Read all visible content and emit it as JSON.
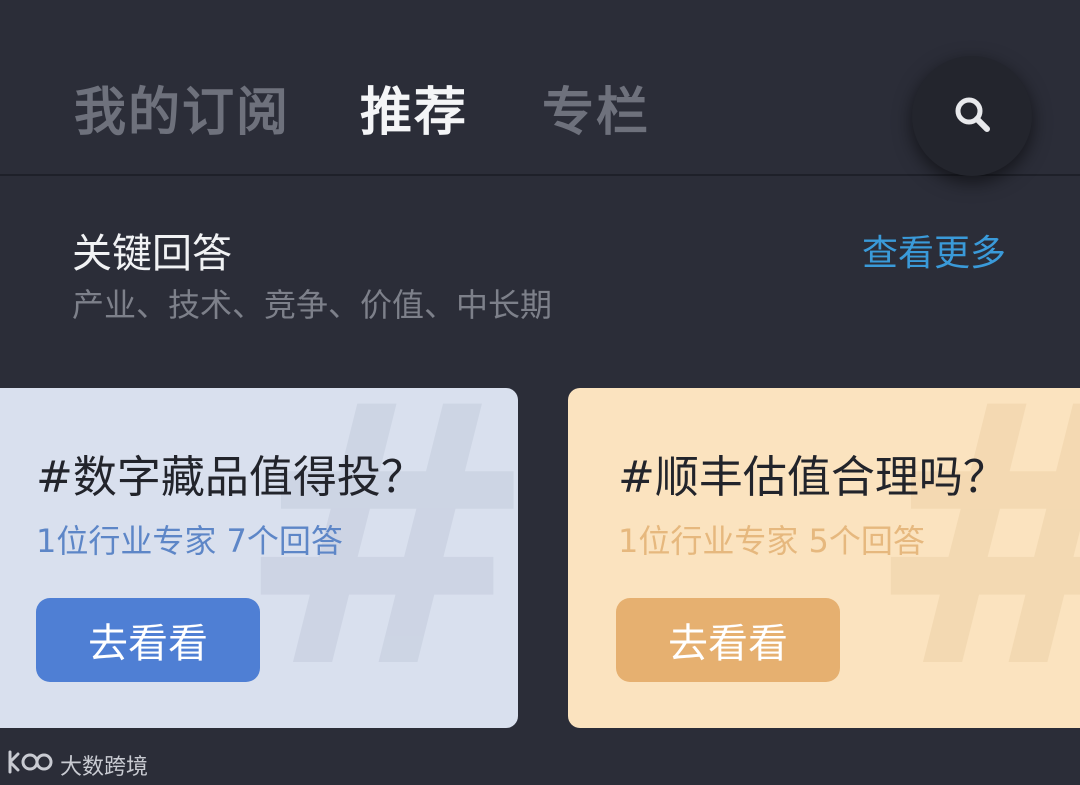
{
  "tabs": [
    {
      "label": "我的订阅",
      "active": false
    },
    {
      "label": "推荐",
      "active": true
    },
    {
      "label": "专栏",
      "active": false
    }
  ],
  "search": {
    "icon": "search-icon"
  },
  "section": {
    "title": "关键回答",
    "subtitle": "产业、技术、竞争、价值、中长期",
    "see_more": "查看更多"
  },
  "cards": [
    {
      "title": "#数字藏品值得投？",
      "meta": "1位行业专家  7个回答",
      "button": "去看看",
      "bg": "#d9e0ee",
      "accent": "#4f7fd4"
    },
    {
      "title": "#顺丰估值合理吗？",
      "meta": "1位行业专家  5个回答",
      "button": "去看看",
      "bg": "#fbe3bf",
      "accent": "#e6b070"
    }
  ],
  "watermark": {
    "text": "大数跨境",
    "icon": "brand-logo"
  },
  "colors": {
    "background": "#2b2d38",
    "link": "#3a9ad9"
  }
}
